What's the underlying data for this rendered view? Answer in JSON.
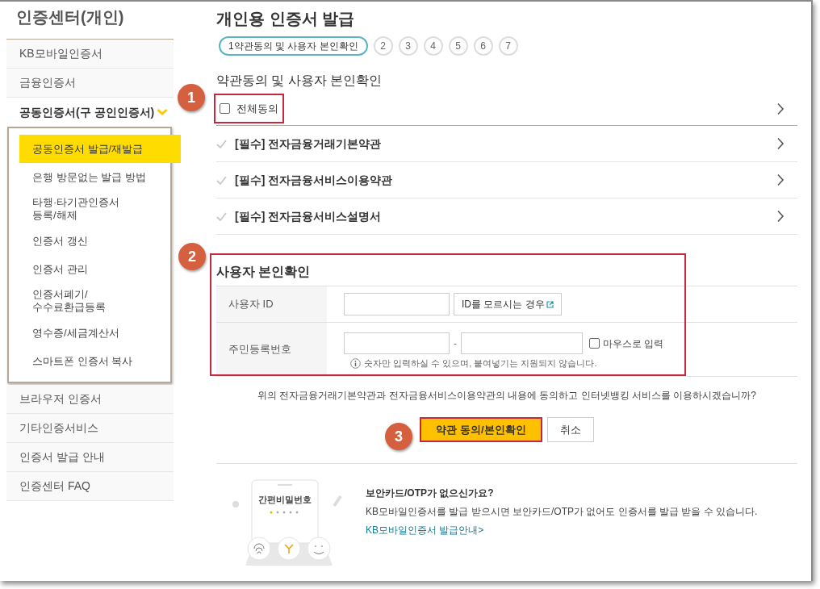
{
  "sidebar": {
    "title": "인증센터(개인)",
    "items": [
      {
        "label": "KB모바일인증서",
        "expanded": false
      },
      {
        "label": "금융인증서",
        "expanded": false
      },
      {
        "label": "공동인증서(구 공인인증서)",
        "expanded": true,
        "children": [
          {
            "label": "공동인증서 발급/재발급",
            "selected": true
          },
          {
            "label": "은행 방문없는 발급 방법",
            "selected": false
          },
          {
            "label": "타행·타기관인증서\n등록/해제",
            "selected": false
          },
          {
            "label": "인증서 갱신",
            "selected": false
          },
          {
            "label": "인증서 관리",
            "selected": false
          },
          {
            "label": "인증서폐기/\n수수료환급등록",
            "selected": false
          },
          {
            "label": "영수증/세금계산서",
            "selected": false
          },
          {
            "label": "스마트폰 인증서 복사",
            "selected": false
          }
        ]
      },
      {
        "label": "브라우저 인증서",
        "expanded": false
      },
      {
        "label": "기타인증서비스",
        "expanded": false
      },
      {
        "label": "인증서 발급 안내",
        "expanded": false
      },
      {
        "label": "인증센터 FAQ",
        "expanded": false
      }
    ]
  },
  "main": {
    "title": "개인용 인증서 발급",
    "steps": [
      {
        "label": "1약관동의 및 사용자 본인확인",
        "selected": true
      },
      {
        "label": "2",
        "selected": false
      },
      {
        "label": "3",
        "selected": false
      },
      {
        "label": "4",
        "selected": false
      },
      {
        "label": "5",
        "selected": false
      },
      {
        "label": "6",
        "selected": false
      },
      {
        "label": "7",
        "selected": false
      }
    ],
    "section_title": "약관동의 및 사용자 본인확인",
    "agree_all": {
      "label": "전체동의",
      "checked": false
    },
    "terms": [
      {
        "label": "[필수] 전자금융거래기본약관",
        "checked": false
      },
      {
        "label": "[필수] 전자금융서비스이용약관",
        "checked": false
      },
      {
        "label": "[필수] 전자금융서비스설명서",
        "checked": false
      }
    ],
    "identity": {
      "title": "사용자 본인확인",
      "id_label": "사용자 ID",
      "id_help_button": "ID를 모르시는 경우",
      "rrn_label": "주민등록번호",
      "rrn_separator": "-",
      "mouse_input": {
        "label": "마우스로 입력",
        "checked": false
      },
      "hint": "숫자만 입력하실 수 있으며, 붙여넣기는 지원되지 않습니다."
    },
    "question": "위의 전자금융거래기본약관과 전자금융서비스이용약관의 내용에 동의하고 인터넷뱅킹 서비스를 이용하시겠습니까?",
    "buttons": [
      {
        "label": "약관 동의/본인확인",
        "kind": "primary"
      },
      {
        "label": "취소",
        "kind": "secondary"
      }
    ],
    "promo": {
      "phone_label": "간편비밀번호",
      "title": "보안카드/OTP가 없으신가요?",
      "text": "KB모바일인증서를 발급 받으시면 보안카드/OTP가 없어도 인증서를 발급 받을 수 있습니다.",
      "link": "KB모바일인증서 발급안내>"
    }
  },
  "annotations": [
    "1",
    "2",
    "3"
  ]
}
